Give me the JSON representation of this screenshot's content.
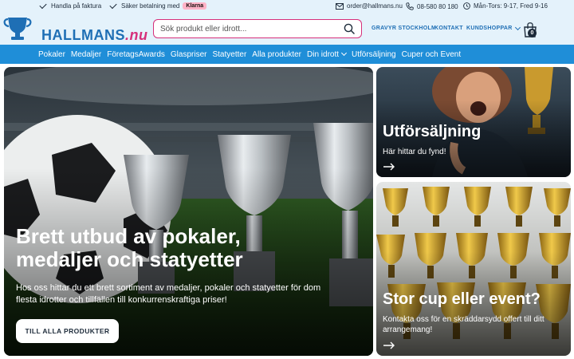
{
  "topbar": {
    "usp": [
      "Handla på faktura",
      "Säker betalning med"
    ],
    "klarna": "Klarna",
    "email": "order@hallmans.nu",
    "phone": "08-580 80 180",
    "hours": "Mån-Tors: 9-17, Fred 9-16"
  },
  "header": {
    "logo_main": "HALLMANS",
    "logo_tld": ".nu",
    "search_placeholder": "Sök produkt eller idrott...",
    "links": [
      "GRAVYR STOCKHOLM",
      "KONTAKT",
      "KUNDSHOPPAR"
    ],
    "cart_count": "0"
  },
  "nav": {
    "items": [
      "Pokaler",
      "Medaljer",
      "FöretagsAwards",
      "Glaspriser",
      "Statyetter",
      "Alla produkter",
      "Din idrott",
      "Utförsäljning",
      "Cuper och Event"
    ]
  },
  "hero": {
    "title": "Brett utbud av pokaler, medaljer och statyetter",
    "subtitle": "Hos oss hittar du ett brett sortiment av medaljer, pokaler och statyetter för dom flesta idrotter och tillfällen till konkurrenskraftiga priser!",
    "button": "TILL ALLA PRODUKTER"
  },
  "cards": [
    {
      "title": "Utförsäljning",
      "subtitle": "Här hittar du fynd!"
    },
    {
      "title": "Stor cup eller event?",
      "subtitle": "Kontakta oss för en skräddarsydd offert till ditt arrangemang!"
    }
  ],
  "colors": {
    "brand_blue": "#1f6fb5",
    "nav_blue": "#1f8ed8",
    "accent_pink": "#d62f7a",
    "topbar_bg": "#e4f2fb"
  }
}
